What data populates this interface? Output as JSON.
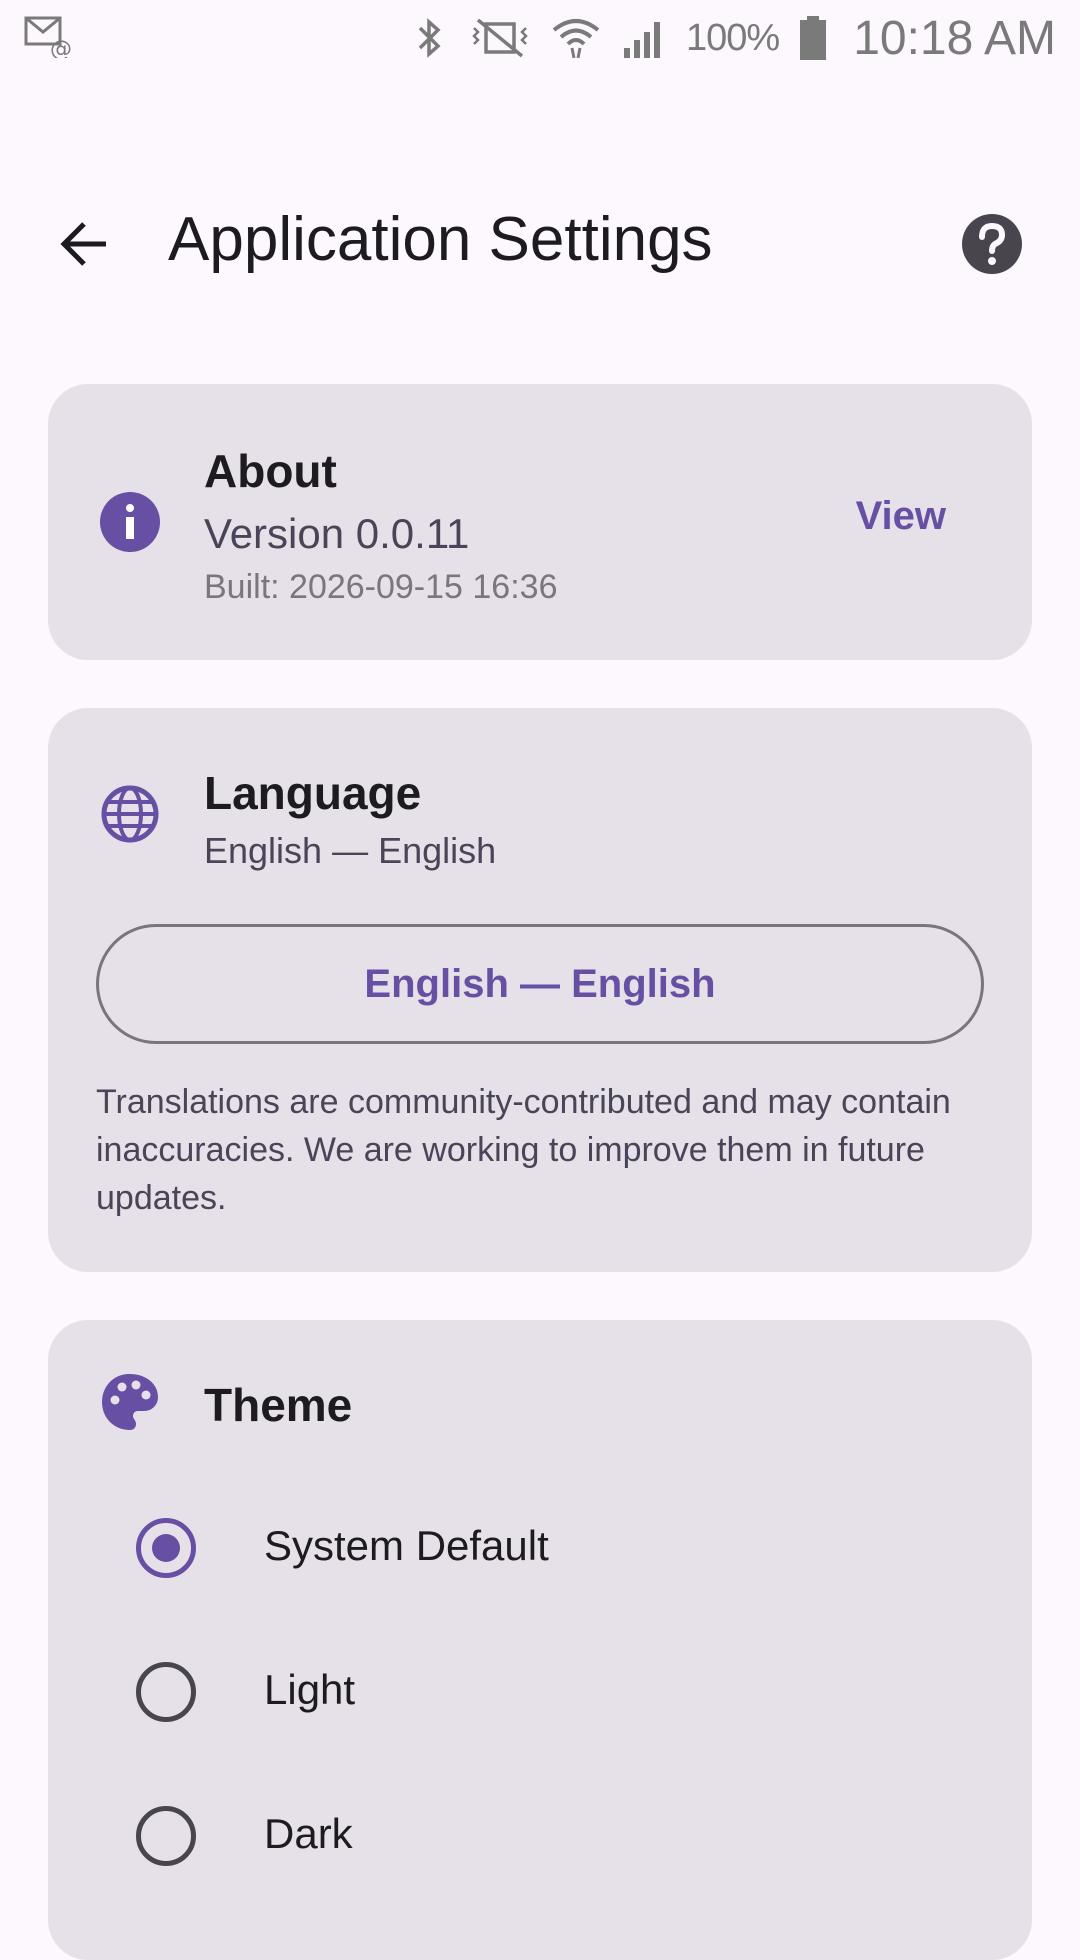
{
  "status_bar": {
    "battery": "100%",
    "time": "10:18 AM",
    "icons": [
      "email-notification-icon",
      "bluetooth-icon",
      "vibrate-mute-icon",
      "wifi-icon",
      "signal-icon",
      "battery-icon"
    ]
  },
  "app_bar": {
    "title": "Application Settings",
    "back_icon": "arrow-back-icon",
    "help_icon": "help-icon"
  },
  "about": {
    "title": "About",
    "version": "Version 0.0.11",
    "built": "Built: 2026-09-15 16:36",
    "view_label": "View",
    "icon": "info-icon"
  },
  "language": {
    "title": "Language",
    "current": "English — English",
    "button_label": "English — English",
    "note": "Translations are community-contributed and may contain inaccuracies. We are working to improve them in future updates.",
    "icon": "globe-icon"
  },
  "theme": {
    "title": "Theme",
    "icon": "palette-icon",
    "options": [
      {
        "label": "System Default",
        "selected": true
      },
      {
        "label": "Light",
        "selected": false
      },
      {
        "label": "Dark",
        "selected": false
      }
    ]
  },
  "colors": {
    "accent": "#6750A4",
    "card": "#E6E0E8",
    "background": "#FDF7FE"
  }
}
